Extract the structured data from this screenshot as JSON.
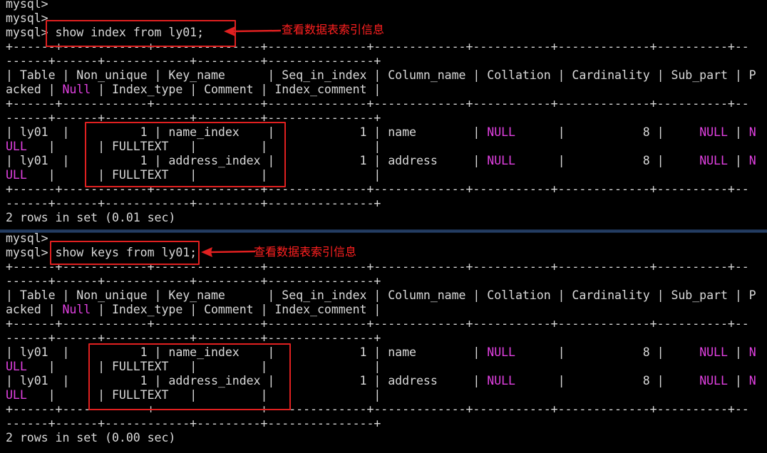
{
  "colors": {
    "background": "#000000",
    "text": "#d8d8d8",
    "null_text": "#e040e0",
    "annotation": "#ff2020"
  },
  "panels": [
    {
      "lines": [
        "mysql>",
        "mysql>",
        "mysql> show index from ly01;",
        "+------+------------+---------------+--------------+-------------+-----------+-------------+----------+--",
        "------+------+------------+---------+---------------+",
        "| Table | Non_unique | Key_name      | Seq_in_index | Column_name | Collation | Cardinality | Sub_part | P",
        "acked | Null | Index_type | Comment | Index_comment |",
        "+------+------------+---------------+--------------+-------------+-----------+-------------+----------+--",
        "------+------+------------+---------+---------------+",
        "| ly01  |          1 | name_index    |            1 | name        | NULL      |           8 |     NULL | N",
        "ULL   |      | FULLTEXT   |         |               |",
        "| ly01  |          1 | address_index |            1 | address     | NULL      |           8 |     NULL | N",
        "ULL   |      | FULLTEXT   |         |               |",
        "+------+------------+---------------+--------------+-------------+-----------+-------------+----------+--",
        "------+------+------------+---------+---------------+",
        "2 rows in set (0.01 sec)"
      ],
      "annotation": "查看数据表索引信息"
    },
    {
      "lines": [
        "mysql>",
        "mysql> show keys from ly01;",
        "+------+------------+---------------+--------------+-------------+-----------+-------------+----------+--",
        "------+------+------------+---------+---------------+",
        "| Table | Non_unique | Key_name      | Seq_in_index | Column_name | Collation | Cardinality | Sub_part | P",
        "acked | Null | Index_type | Comment | Index_comment |",
        "+------+------------+---------------+--------------+-------------+-----------+-------------+----------+--",
        "------+------+------------+---------+---------------+",
        "| ly01  |          1 | name_index    |            1 | name        | NULL      |           8 |     NULL | N",
        "ULL   |      | FULLTEXT   |         |               |",
        "| ly01  |          1 | address_index |            1 | address     | NULL      |           8 |     NULL | N",
        "ULL   |      | FULLTEXT   |         |               |",
        "+------+------------+---------------+--------------+-------------+-----------+-------------+----------+--",
        "------+------+------------+---------+---------------+",
        "2 rows in set (0.00 sec)"
      ],
      "annotation": "查看数据表索引信息"
    }
  ]
}
